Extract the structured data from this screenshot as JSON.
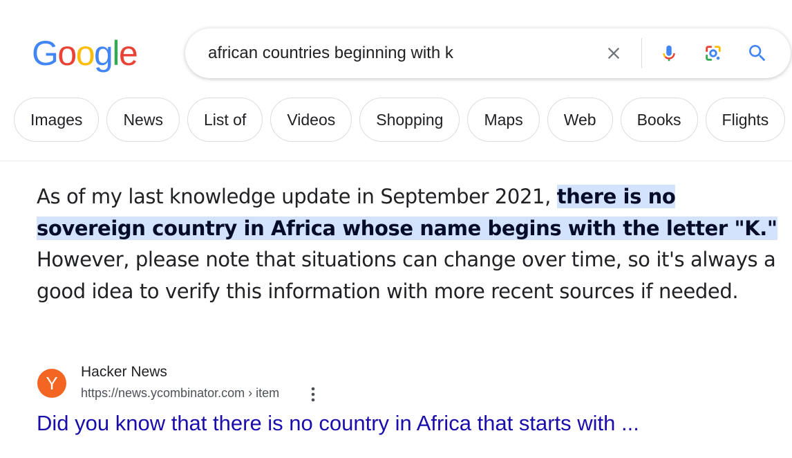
{
  "logo": {
    "letters": [
      "G",
      "o",
      "o",
      "g",
      "l",
      "e"
    ],
    "colors": [
      "#4285F4",
      "#EA4335",
      "#FBBC05",
      "#4285F4",
      "#34A853",
      "#EA4335"
    ]
  },
  "search": {
    "value": "african countries beginning with k",
    "clear_icon": "close-icon",
    "mic_icon": "mic-icon",
    "lens_icon": "lens-icon",
    "search_icon": "search-icon"
  },
  "chips": [
    "Images",
    "News",
    "List of",
    "Videos",
    "Shopping",
    "Maps",
    "Web",
    "Books",
    "Flights"
  ],
  "answer": {
    "before": "As of my last knowledge update in September 2021, ",
    "highlight": "there is no sovereign country in Africa whose name begins with the letter \"K.\"",
    "after": " However, please note that situations can change over time, so it's always a good idea to verify this information with more recent sources if needed."
  },
  "result": {
    "favicon_letter": "Y",
    "site_name": "Hacker News",
    "url": "https://news.ycombinator.com › item",
    "title": "Did you know that there is no country in Africa that starts with ..."
  },
  "colors": {
    "accent_blue": "#4285F4",
    "link": "#1a0dab",
    "highlight": "#d3e3fd",
    "favicon_bg": "#f26522"
  }
}
